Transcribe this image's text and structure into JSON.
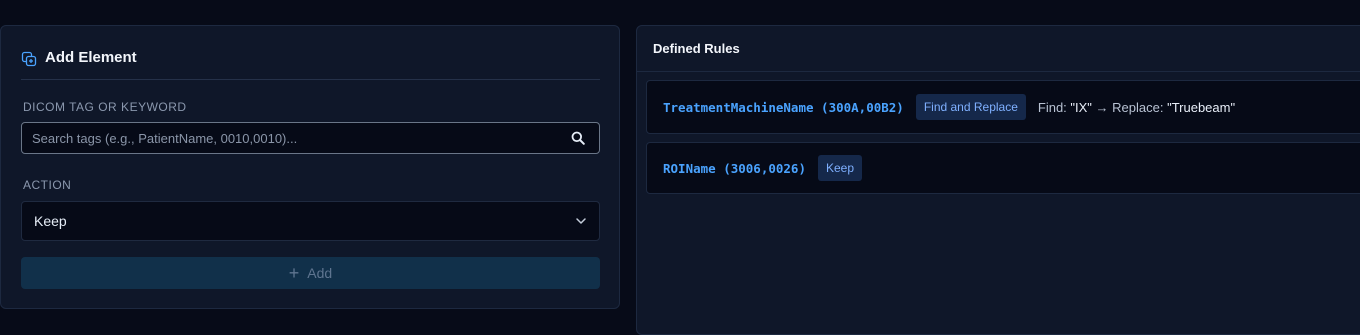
{
  "add_element": {
    "title": "Add Element",
    "tag_label": "DICOM TAG OR KEYWORD",
    "search_placeholder": "Search tags (e.g., PatientName, 0010,0010)...",
    "action_label": "ACTION",
    "action_value": "Keep",
    "add_button_label": "Add"
  },
  "rules_panel": {
    "title": "Defined Rules",
    "rules": [
      {
        "tag": "TreatmentMachineName (300A,00B2)",
        "action": "Find and Replace",
        "find_label": "Find: ",
        "find_value": "\"IX\"",
        "arrow": " → ",
        "replace_label": "Replace: ",
        "replace_value": "\"Truebeam\""
      },
      {
        "tag": "ROIName (3006,0026)",
        "action": "Keep"
      }
    ]
  },
  "colors": {
    "background": "#070b18",
    "panel": "#0f1729",
    "accent": "#4aa3ff",
    "badge": "#15284a"
  }
}
